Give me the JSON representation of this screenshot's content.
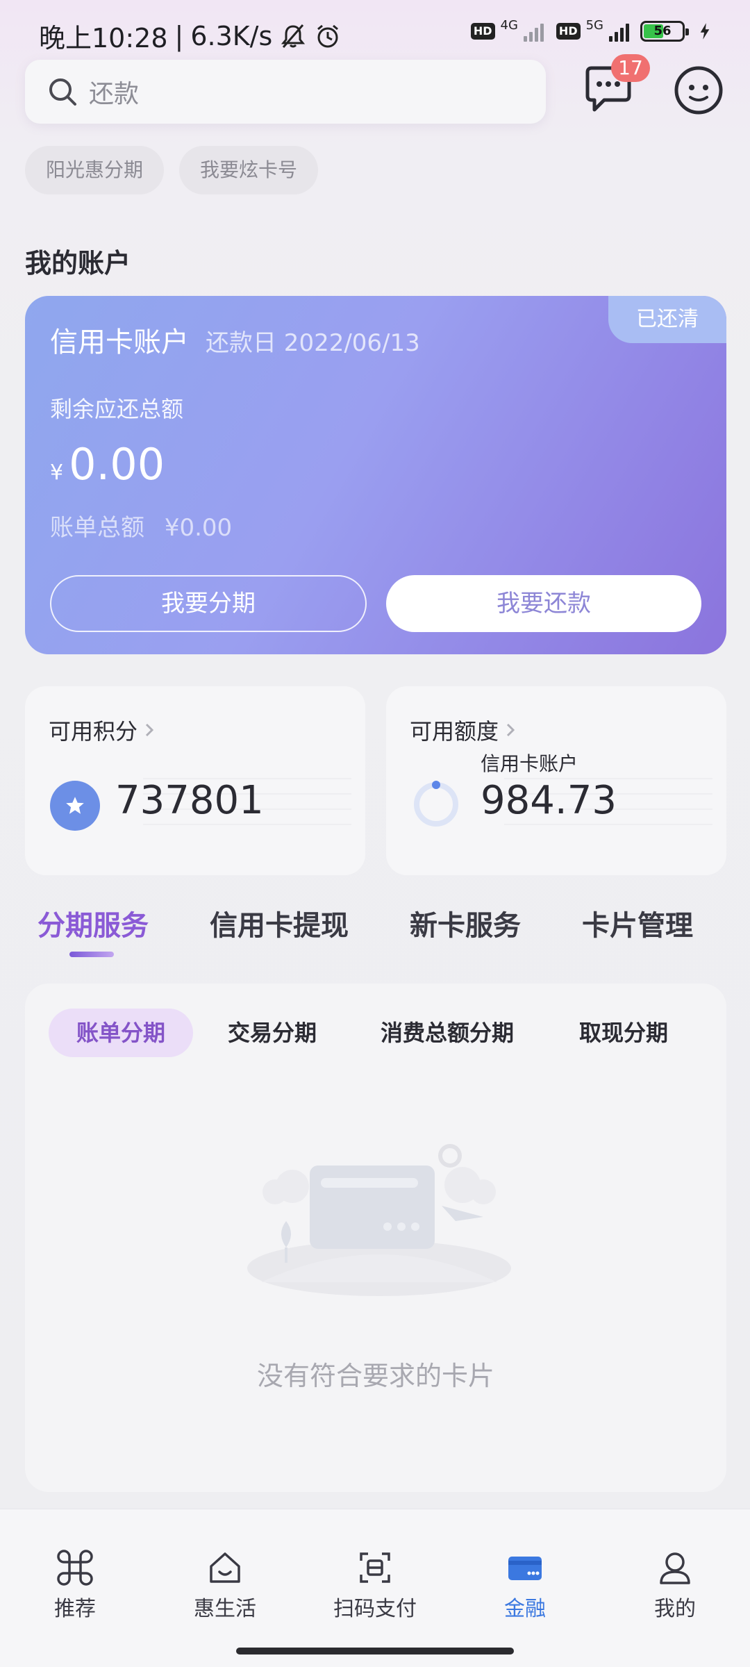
{
  "status_bar": {
    "time": "晚上10:28",
    "speed": "6.3K/s",
    "sim1_label": "HD",
    "sim1_net": "4G",
    "sim2_label": "HD",
    "sim2_net": "5G",
    "battery": "56",
    "battery_level": 0.56
  },
  "header": {
    "search_placeholder": "还款",
    "message_badge": "17"
  },
  "chips": [
    "阳光惠分期",
    "我要炫卡号"
  ],
  "account": {
    "section_title": "我的账户",
    "card_title": "信用卡账户",
    "due_date": "还款日 2022/06/13",
    "status": "已还清",
    "remaining_label": "剩余应还总额",
    "currency": "¥",
    "remaining_amount": "0.00",
    "bill_label": "账单总额",
    "bill_amount": "¥0.00",
    "installment_button": "我要分期",
    "repay_button": "我要还款"
  },
  "points": {
    "title": "可用积分",
    "value": "737801"
  },
  "quota": {
    "title": "可用额度",
    "subtitle": "信用卡账户",
    "value": "984.73"
  },
  "service_tabs": [
    "分期服务",
    "信用卡提现",
    "新卡服务",
    "卡片管理"
  ],
  "sub_tabs": [
    "账单分期",
    "交易分期",
    "消费总额分期",
    "取现分期"
  ],
  "empty_text": "没有符合要求的卡片",
  "bottom_nav": [
    {
      "label": "推荐",
      "icon": "recommend-icon"
    },
    {
      "label": "惠生活",
      "icon": "life-house-icon"
    },
    {
      "label": "扫码支付",
      "icon": "scan-icon"
    },
    {
      "label": "金融",
      "icon": "card-icon",
      "active": true
    },
    {
      "label": "我的",
      "icon": "profile-icon"
    }
  ],
  "colors": {
    "accent_purple": "#8a5ad6",
    "nav_active": "#3b78e0",
    "badge_red": "#f07070"
  }
}
